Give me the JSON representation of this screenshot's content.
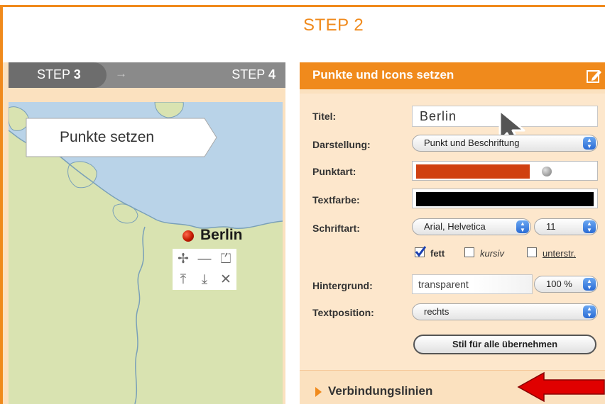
{
  "title": "STEP 2",
  "steps": {
    "step3_prefix": "STEP",
    "step3_number": "3",
    "step4_prefix": "STEP",
    "step4_number": "4",
    "arrow": "→"
  },
  "map": {
    "callout_text": "Punkte setzen",
    "city_label": "Berlin",
    "tools": [
      "move-icon",
      "minus-icon",
      "export-icon",
      "top-icon",
      "bottom-icon",
      "close-icon"
    ],
    "tool_glyphs": [
      "✢",
      "—",
      "⏍",
      "⤒",
      "⤓",
      "✕"
    ]
  },
  "panel": {
    "title": "Punkte und Icons setzen",
    "labels": {
      "titel": "Titel:",
      "darstellung": "Darstellung:",
      "punktart": "Punktart:",
      "textfarbe": "Textfarbe:",
      "schriftart": "Schriftart:",
      "hintergrund": "Hintergrund:",
      "textposition": "Textposition:"
    },
    "titel_value": "Berlin",
    "darstellung_value": "Punkt und Beschriftung",
    "punkt_color": "#d04010",
    "text_color": "#000000",
    "font_value": "Arial, Helvetica",
    "size_value": "11",
    "checkboxes": {
      "fett": "fett",
      "kursiv": "kursiv",
      "unterstr": "unterstr."
    },
    "hintergrund_value": "transparent",
    "opacity_value": "100 %",
    "textposition_value": "rechts",
    "apply_button": "Stil für alle übernehmen",
    "section": "Verbindungslinien"
  },
  "colors": {
    "accent": "#f08a1c",
    "panel_bg": "#fbe1bf",
    "map_land": "#d9e3b1",
    "map_sea": "#b9d3e8",
    "arrow_red": "#e00000"
  }
}
